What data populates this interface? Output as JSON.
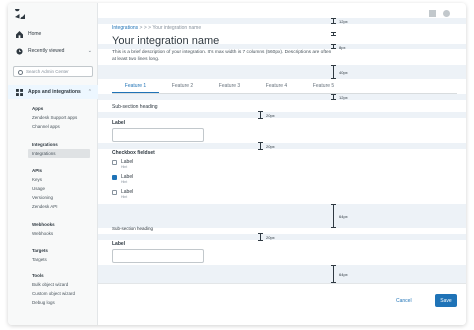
{
  "sidebar": {
    "home": "Home",
    "recently_viewed": "Recently viewed",
    "search_placeholder": "Search Admin Center",
    "apps_integrations": "Apps and integrations",
    "sections": [
      {
        "head": "Apps",
        "items": [
          "Zendesk Support apps",
          "Channel apps"
        ]
      },
      {
        "head": "Integrations",
        "items": [
          "Integrations"
        ]
      },
      {
        "head": "APIs",
        "items": [
          "Keys",
          "Usage",
          "Versioning",
          "Zendesk API"
        ]
      },
      {
        "head": "Webhooks",
        "items": [
          "Webhooks"
        ]
      },
      {
        "head": "Targets",
        "items": [
          "Targets"
        ]
      },
      {
        "head": "Tools",
        "items": [
          "Bulk object wizard",
          "Custom object wizard",
          "Debug logs"
        ]
      }
    ]
  },
  "breadcrumb": {
    "link": "Integrations",
    "sep": " > > > ",
    "current": "Your integration name"
  },
  "page": {
    "title": "Your integration name",
    "description": "This is a brief description of your integration. It’s max width is 7 columns (560px). Descriptions are often at least two lines long."
  },
  "tabs": [
    "Feature 1",
    "Feature 2",
    "Feature 3",
    "Feature 4",
    "Feature 5"
  ],
  "spacing": {
    "s12a": "12px",
    "s8": "8px",
    "s40": "40px",
    "s12b": "12px",
    "s20a": "20px",
    "s20b": "20px",
    "s64a": "64px",
    "s20c": "20px",
    "s64b": "64px"
  },
  "form": {
    "section1_heading": "Sub-section heading",
    "label1": "Label",
    "fieldset_legend": "Checkbox fieldset",
    "checkboxes": [
      {
        "label": "Label",
        "hint": "Hint",
        "checked": false
      },
      {
        "label": "Label",
        "hint": "Hint",
        "checked": true
      },
      {
        "label": "Label",
        "hint": "Hint",
        "checked": false
      }
    ],
    "section2_heading": "Sub-section heading",
    "label2": "Label"
  },
  "footer": {
    "cancel": "Cancel",
    "save": "Save"
  }
}
